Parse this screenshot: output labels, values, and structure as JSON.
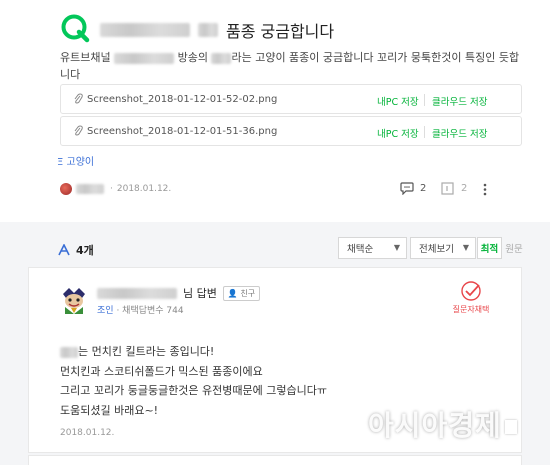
{
  "question": {
    "title_suffix": "품종 궁금합니다",
    "body_prefix": "유트브채널 ",
    "body_mid1": " 방송의 ",
    "body_mid2": "라는 고양이 품종이 궁금합니다 꼬리가 뭉툭한것이 특징인 듯합니다",
    "attachments": [
      {
        "filename": "Screenshot_2018-01-12-01-52-02.png",
        "save_pc": "내PC 저장",
        "save_cloud": "클라우드 저장"
      },
      {
        "filename": "Screenshot_2018-01-12-01-51-36.png",
        "save_pc": "내PC 저장",
        "save_cloud": "클라우드 저장"
      }
    ],
    "tag": "Ξ 고양이",
    "date": "2018.01.12.",
    "comment_count": "2",
    "share_count": "2"
  },
  "answers": {
    "count": "4개",
    "sort_select": "채택순",
    "view_select": "전체보기",
    "sort_latest": "최적",
    "sort_original": "원문",
    "card": {
      "name_suffix": "님 답변",
      "friend_label": "친구",
      "level": "조인",
      "adopt_info": "채택답변수 744",
      "selected_badge": "질문자채택",
      "lines": [
        "는 먼치킨 킬트라는 종입니다!",
        "먼치킨과 스코티쉬폴드가 믹스된 품종이에요",
        "그리고 꼬리가 둥글둥글한것은 유전병때문에 그렇습니다ㅠ",
        "도움되셨길 바래요~!"
      ],
      "date": "2018.01.12."
    }
  },
  "watermark": "아시아경제",
  "colors": {
    "brand_green": "#03c75a",
    "link_blue": "#3b6fd6",
    "accent_red": "#e8464a"
  }
}
